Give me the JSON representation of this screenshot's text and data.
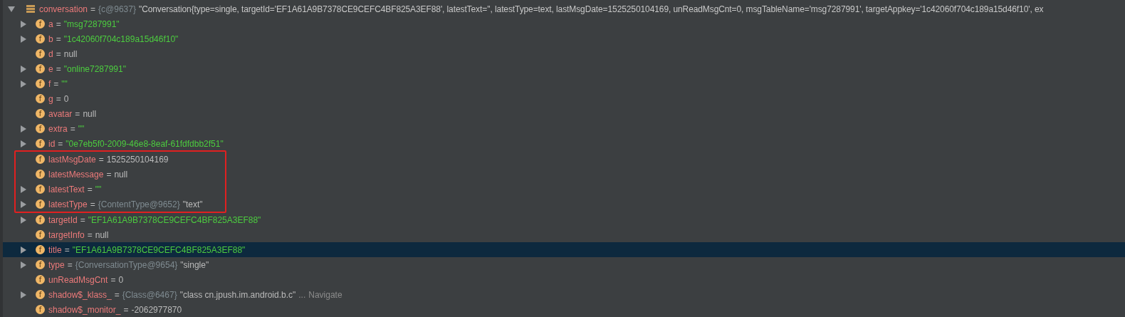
{
  "variables": {
    "name": "conversation",
    "eq": "=",
    "type_ref": "{c@9637}",
    "value": "\"Conversation{type=single, targetId='EF1A61A9B7378CE9CEFC4BF825A3EF88', latestText='', latestType=text, lastMsgDate=1525250104169, unReadMsgCnt=0, msgTableName='msg7287991', targetAppkey='1c42060f704c189a15d46f10', ex",
    "kind": "object",
    "expanded": true,
    "children": [
      {
        "icon": "f",
        "name": "a",
        "eq": "=",
        "value": "\"msg7287991\"",
        "kind": "string",
        "expandable": true,
        "selected": false
      },
      {
        "icon": "f",
        "name": "b",
        "eq": "=",
        "value": "\"1c42060f704c189a15d46f10\"",
        "kind": "string",
        "expandable": true,
        "selected": false
      },
      {
        "icon": "f",
        "name": "d",
        "eq": "=",
        "value": "null",
        "kind": "plain",
        "selected": false
      },
      {
        "icon": "f",
        "name": "e",
        "eq": "=",
        "value": "\"online7287991\"",
        "kind": "string",
        "expandable": true,
        "selected": false
      },
      {
        "icon": "f",
        "name": "f",
        "eq": "=",
        "value": "\"\"",
        "kind": "string",
        "expandable": true,
        "selected": false
      },
      {
        "icon": "f",
        "name": "g",
        "eq": "=",
        "value": "0",
        "kind": "plain",
        "selected": false
      },
      {
        "icon": "f",
        "name": "avatar",
        "eq": "=",
        "value": "null",
        "kind": "plain",
        "selected": false
      },
      {
        "icon": "f",
        "name": "extra",
        "eq": "=",
        "value": "\"\"",
        "kind": "string",
        "expandable": true,
        "selected": false
      },
      {
        "icon": "f",
        "name": "id",
        "eq": "=",
        "value": "\"0e7eb5f0-2009-46e8-8eaf-61fdfdbb2f51\"",
        "kind": "string",
        "expandable": true,
        "selected": false
      },
      {
        "icon": "f",
        "name": "lastMsgDate",
        "eq": "=",
        "value": "1525250104169",
        "kind": "plain",
        "selected": false,
        "boxed": true
      },
      {
        "icon": "f",
        "name": "latestMessage",
        "eq": "=",
        "value": "null",
        "kind": "plain",
        "selected": false,
        "boxed": true
      },
      {
        "icon": "f",
        "name": "latestText",
        "eq": "=",
        "value": "\"\"",
        "kind": "string",
        "expandable": true,
        "selected": false,
        "boxed": true
      },
      {
        "icon": "f",
        "name": "latestType",
        "eq": "=",
        "type_ref": "{ContentType@9652}",
        "value": "\"text\"",
        "kind": "plain",
        "expandable": true,
        "selected": false,
        "boxed": true
      },
      {
        "icon": "f",
        "name": "targetId",
        "eq": "=",
        "value": "\"EF1A61A9B7378CE9CEFC4BF825A3EF88\"",
        "kind": "string",
        "expandable": true,
        "selected": false
      },
      {
        "icon": "f",
        "name": "targetInfo",
        "eq": "=",
        "value": "null",
        "kind": "plain",
        "selected": false
      },
      {
        "icon": "f",
        "name": "title",
        "eq": "=",
        "value": "\"EF1A61A9B7378CE9CEFC4BF825A3EF88\"",
        "kind": "string",
        "expandable": true,
        "selected": true
      },
      {
        "icon": "f",
        "name": "type",
        "eq": "=",
        "type_ref": "{ConversationType@9654}",
        "value": "\"single\"",
        "kind": "plain",
        "expandable": true,
        "selected": false
      },
      {
        "icon": "f",
        "name": "unReadMsgCnt",
        "eq": "=",
        "value": "0",
        "kind": "plain",
        "selected": false
      },
      {
        "icon": "f",
        "name": "shadow$_klass_",
        "eq": "=",
        "type_ref": "{Class@6467}",
        "value": "\"class cn.jpush.im.android.b.c\"",
        "more": "...",
        "link": "Navigate",
        "kind": "plain",
        "expandable": true,
        "selected": false
      },
      {
        "icon": "f",
        "name": "shadow$_monitor_",
        "eq": "=",
        "value": "-2062977870",
        "kind": "plain",
        "selected": false
      }
    ]
  }
}
